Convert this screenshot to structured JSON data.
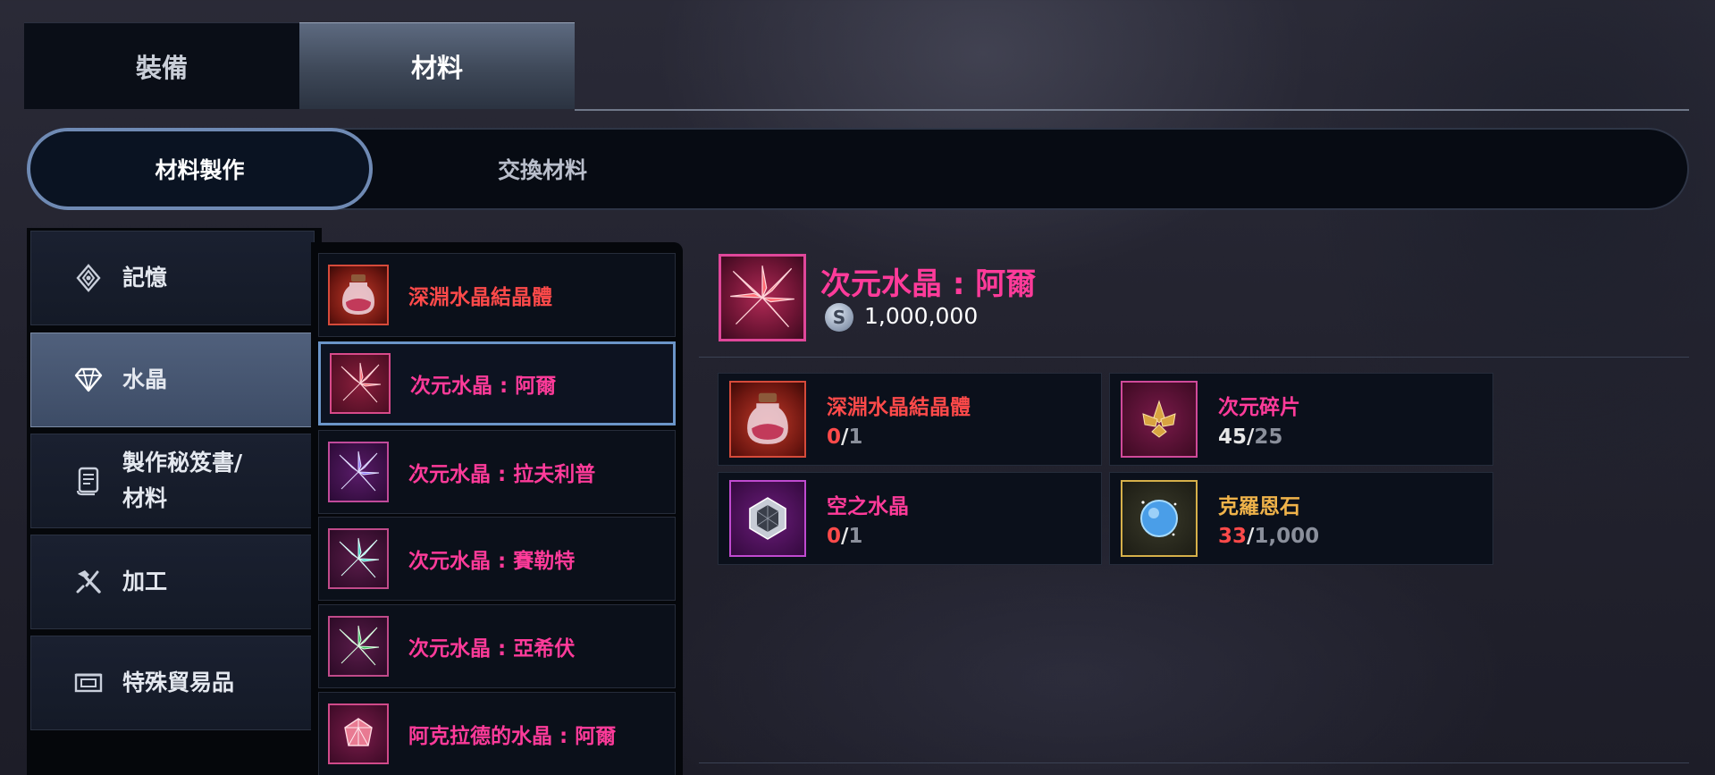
{
  "main_tabs": [
    {
      "label": "裝備",
      "active": false
    },
    {
      "label": "材料",
      "active": true
    }
  ],
  "sub_tabs": [
    {
      "label": "材料製作",
      "active": true
    },
    {
      "label": "交換材料",
      "active": false
    }
  ],
  "categories": [
    {
      "label": "記憶",
      "icon": "memory-icon",
      "active": false
    },
    {
      "label": "水晶",
      "icon": "diamond-icon",
      "active": true
    },
    {
      "label_line1": "製作秘笈書/",
      "label_line2": "材料",
      "icon": "scroll-icon",
      "active": false
    },
    {
      "label": "加工",
      "icon": "hammer-icon",
      "active": false
    },
    {
      "label": "特殊貿易品",
      "icon": "ticket-icon",
      "active": false
    }
  ],
  "recipes": [
    {
      "label": "深淵水晶結晶體",
      "color": "#ff4a4a",
      "icon": "crystal-jar-icon",
      "selected": false
    },
    {
      "label": "次元水晶 : 阿爾",
      "color": "#ff3b9a",
      "icon": "red-crystal-icon",
      "selected": true
    },
    {
      "label": "次元水晶 : 拉夫利普",
      "color": "#ff3b9a",
      "icon": "purple-crystal-icon",
      "selected": false
    },
    {
      "label": "次元水晶 : 賽勒特",
      "color": "#ff3b9a",
      "icon": "teal-crystal-icon",
      "selected": false
    },
    {
      "label": "次元水晶 : 亞希伏",
      "color": "#ff3b9a",
      "icon": "green-crystal-icon",
      "selected": false
    },
    {
      "label": "阿克拉德的水晶 : 阿爾",
      "color": "#ff3b9a",
      "icon": "pink-gem-icon",
      "selected": false
    }
  ],
  "detail": {
    "title": "次元水晶 : 阿爾",
    "title_color": "#ff3b9a",
    "cost": "1,000,000",
    "currency_icon": "silver-coin-icon",
    "currency_symbol": "S"
  },
  "materials": [
    {
      "name": "深淵水晶結晶體",
      "color": "#ff4a4a",
      "have": "0",
      "need": "1",
      "have_color": "red",
      "icon": "crystal-jar-icon"
    },
    {
      "name": "次元碎片",
      "color": "#ff3b9a",
      "have": "45",
      "need": "25",
      "have_color": "white",
      "icon": "gold-shard-icon"
    },
    {
      "name": "空之水晶",
      "color": "#ff3b9a",
      "have": "0",
      "need": "1",
      "have_color": "red",
      "icon": "silver-cube-icon"
    },
    {
      "name": "克羅恩石",
      "color": "#f0b34a",
      "have": "33",
      "need": "1,000",
      "have_color": "red",
      "icon": "blue-orb-icon"
    }
  ]
}
